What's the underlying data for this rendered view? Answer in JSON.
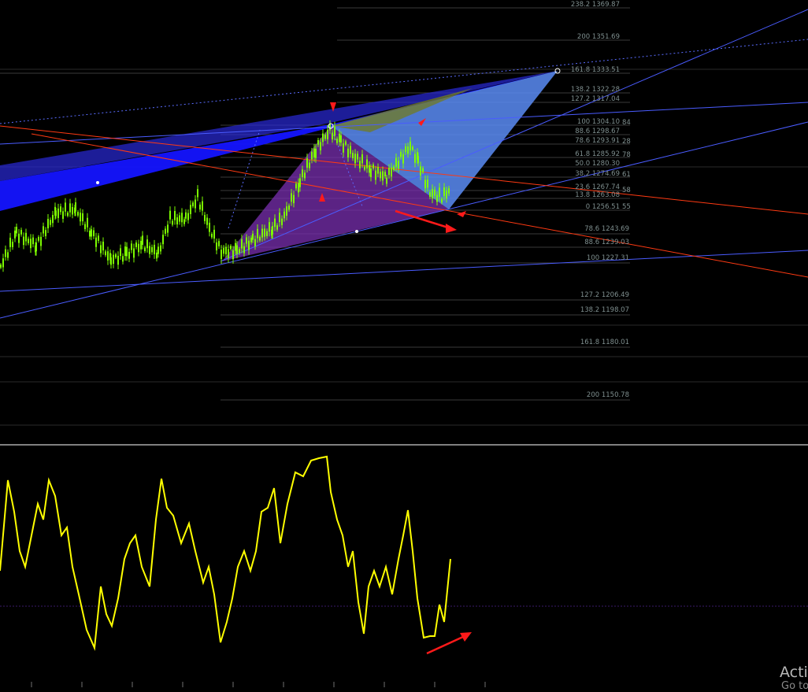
{
  "colors": {
    "background": "#000000",
    "candles": "#7cfc00",
    "oscillator": "#ffff00",
    "fib_lines": "#3a3a3a",
    "trend_lines": "#4a5cff",
    "channel_lines": "#ff3a12",
    "arrows": "#ff1a1a"
  },
  "price_panel": {
    "fib_upper": [
      {
        "label": "238.2 1369.87"
      },
      {
        "label": "200 1351.69"
      },
      {
        "label": "161.8 1333.51"
      },
      {
        "label": "138.2 1322.28"
      },
      {
        "label": "127.2 1317.04"
      },
      {
        "label": "100 1304.10"
      },
      {
        "label": "88.6 1298.67"
      },
      {
        "label": "78.6 1293.91"
      },
      {
        "label": "61.8 1285.92"
      },
      {
        "label": "50.0 1280.30"
      },
      {
        "label": "38.2 1274.69"
      },
      {
        "label": "23.6 1267.74"
      },
      {
        "label": "13.8 1263.08"
      },
      {
        "label": "0 1256.51"
      }
    ],
    "fib_lower": [
      {
        "label": "78.6 1243.69"
      },
      {
        "label": "88.6 1239.03"
      },
      {
        "label": "100 1227.31"
      },
      {
        "label": "127.2 1206.49"
      },
      {
        "label": "138.2 1198.07"
      },
      {
        "label": "161.8 1180.01"
      },
      {
        "label": "200 1150.78"
      }
    ],
    "side_labels": [
      "84",
      "28",
      "78",
      "61",
      "58",
      "55"
    ]
  },
  "watermark": {
    "line1": "Acti",
    "line2": "Go to"
  }
}
